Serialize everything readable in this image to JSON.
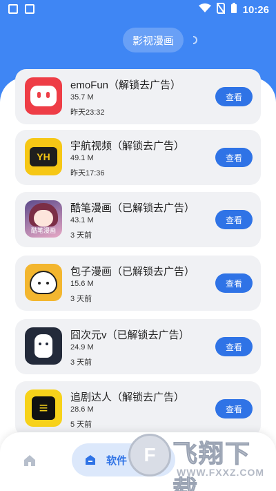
{
  "status_bar": {
    "time": "10:26",
    "left_icons": [
      "image-icon",
      "a-letter-icon"
    ],
    "right_icons": [
      "wifi-icon",
      "no-sim-icon",
      "battery-icon"
    ]
  },
  "header": {
    "title": "影视漫画"
  },
  "apps": [
    {
      "name": "emoFun（解锁去广告）",
      "size": "35.7 M",
      "time": "昨天23:32",
      "button": "查看",
      "icon": "emofun-icon"
    },
    {
      "name": "宇航视频（解锁去广告）",
      "size": "49.1 M",
      "time": "昨天17:36",
      "button": "查看",
      "icon": "yh-tv-icon",
      "icon_text": "YH"
    },
    {
      "name": "酷笔漫画（已解锁去广告）",
      "size": "43.1 M",
      "time": "3 天前",
      "button": "查看",
      "icon": "kubi-comic-icon",
      "icon_text": "酷笔漫画"
    },
    {
      "name": "包子漫画（已解锁去广告）",
      "size": "15.6 M",
      "time": "3 天前",
      "button": "查看",
      "icon": "baozi-comic-icon"
    },
    {
      "name": "囧次元v（已解锁去广告）",
      "size": "24.9 M",
      "time": "3 天前",
      "button": "查看",
      "icon": "jiongciyuan-icon"
    },
    {
      "name": "追剧达人（解锁去广告）",
      "size": "28.6 M",
      "time": "5 天前",
      "button": "查看",
      "icon": "zhuiju-icon"
    }
  ],
  "bottom_nav": {
    "active_label": "软件",
    "items": [
      "home-icon",
      "apps-icon"
    ]
  },
  "watermark": {
    "text": "飞翔下载",
    "url": "WWW.FXXZ.COM"
  },
  "colors": {
    "header_blue": "#3f86f4",
    "button_blue": "#2f73e6",
    "card_gray": "#f0f1f4"
  }
}
